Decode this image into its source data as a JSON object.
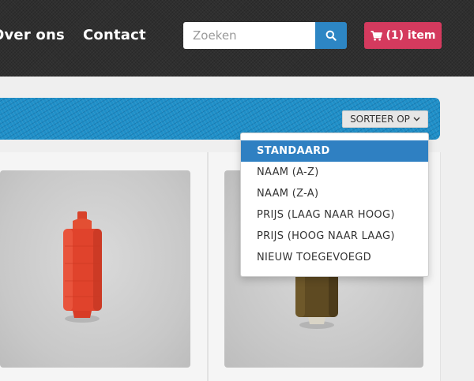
{
  "header": {
    "nav": [
      {
        "label": "Over ons"
      },
      {
        "label": "Contact"
      }
    ],
    "search": {
      "placeholder": "Zoeken",
      "icon": "search-icon"
    },
    "cart": {
      "label": "(1) item",
      "icon": "cart-icon"
    },
    "colors": {
      "search_button": "#2d86c4",
      "cart_button": "#d43a5e"
    }
  },
  "toolbar": {
    "sort_label": "SORTEER OP",
    "sort_icon": "chevron-down-icon",
    "banner_color": "#1f8fc8"
  },
  "sort_menu": {
    "selected": "STANDAARD",
    "options": [
      {
        "label": "STANDAARD"
      },
      {
        "label": "NAAM (A-Z)"
      },
      {
        "label": "NAAM (Z-A)"
      },
      {
        "label": "PRIJS (LAAG NAAR HOOG)"
      },
      {
        "label": "PRIJS (HOOG NAAR LAAG)"
      },
      {
        "label": "NIEUW TOEGEVOEGD"
      }
    ]
  },
  "products": [
    {
      "image": "red-thread-spool",
      "color": "#e0432c"
    },
    {
      "image": "brown-thread-spool",
      "color": "#5e4a22"
    }
  ]
}
